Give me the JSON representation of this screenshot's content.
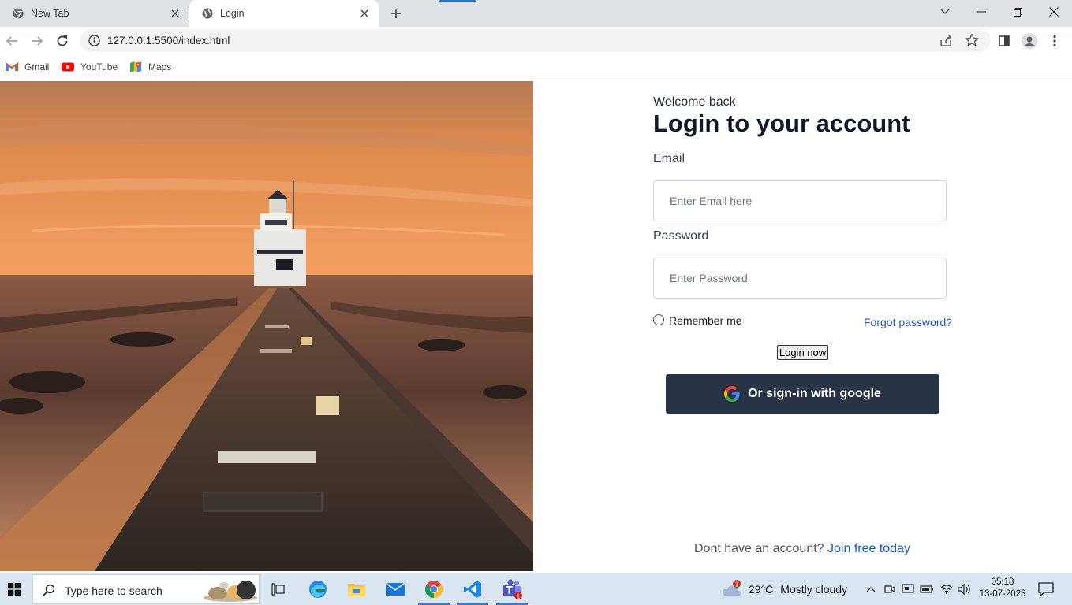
{
  "browser": {
    "tabs": [
      {
        "title": "New Tab",
        "icon": "chrome-icon",
        "active": false
      },
      {
        "title": "Login",
        "icon": "globe-icon",
        "active": true
      }
    ],
    "url": "127.0.0.1:5500/index.html",
    "bookmarks": [
      {
        "label": "Gmail",
        "icon": "gmail-icon"
      },
      {
        "label": "YouTube",
        "icon": "youtube-icon"
      },
      {
        "label": "Maps",
        "icon": "maps-icon"
      }
    ]
  },
  "login": {
    "welcome": "Welcome back",
    "title": "Login to your account",
    "email_label": "Email",
    "email_placeholder": "Enter Email here",
    "email_value": "",
    "password_label": "Password",
    "password_placeholder": "Enter Password",
    "password_value": "",
    "remember_label": "Remember me",
    "remember_checked": false,
    "forgot_link": "Forgot password?",
    "login_button": "Login now",
    "google_button": "Or sign-in with google",
    "signup_prompt": "Dont have an account?",
    "signup_link": "Join free today"
  },
  "taskbar": {
    "search_placeholder": "Type here to search",
    "weather": {
      "badge": "1",
      "temp": "29°C",
      "condition": "Mostly cloudy"
    },
    "time": "05:18",
    "date": "13-07-2023",
    "teams_badge": "1"
  },
  "colors": {
    "google_button_bg": "#283445",
    "link": "#1e5aa8",
    "tab_bar": "#dee1e6",
    "taskbar": "#d9e6f2"
  }
}
